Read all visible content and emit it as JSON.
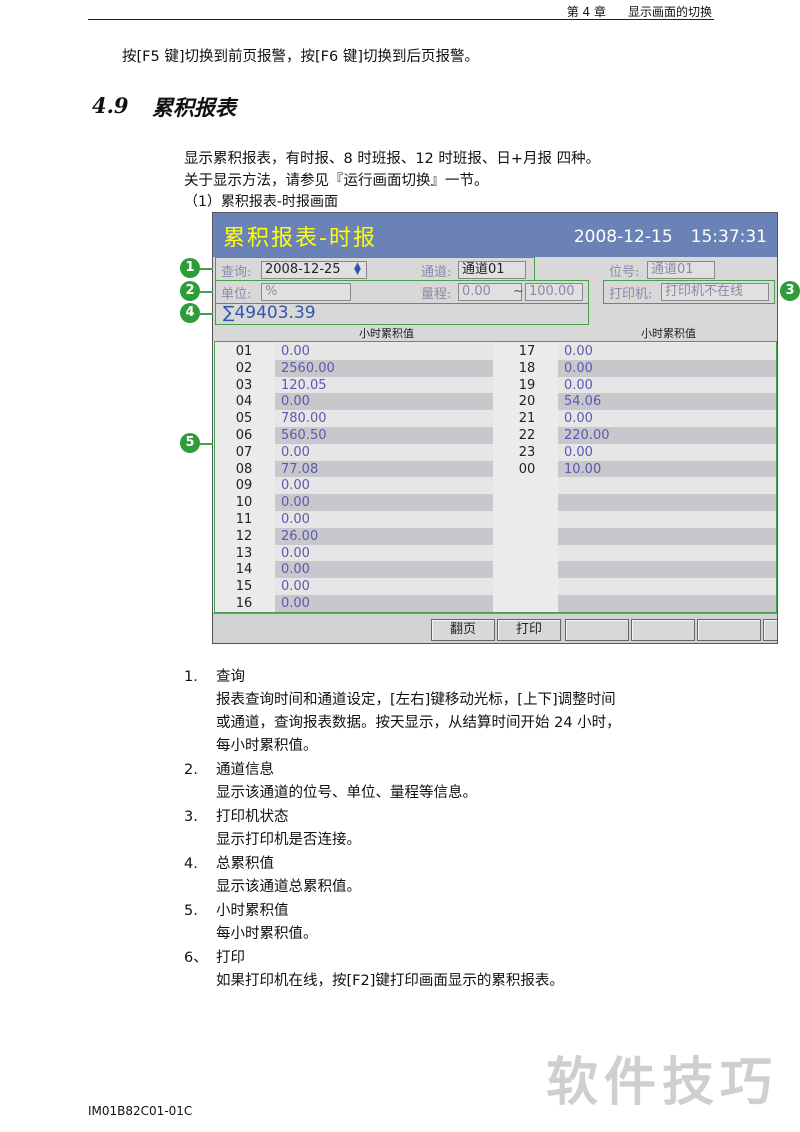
{
  "header": {
    "chapter": "第 4 章",
    "title": "显示画面的切换"
  },
  "intro_line": "按[F5 键]切换到前页报警，按[F6 键]切换到后页报警。",
  "section": {
    "number": "4.9",
    "title": "累积报表"
  },
  "body": {
    "line1": "显示累积报表，有时报、8 时班报、12 时班报、日+月报  四种。",
    "line2": "关于显示方法，请参见『运行画面切换』一节。",
    "fig_caption": "（1）累积报表-时报画面"
  },
  "screen": {
    "title": "累积报表-时报",
    "date": "2008-12-15",
    "time": "15:37:31",
    "query_label": "查询:",
    "query_value": "2008-12-25",
    "channel_label": "通道:",
    "channel_value": "通道01",
    "tag_label": "位号:",
    "tag_value": "通道01",
    "unit_label": "单位:",
    "unit_value": "%",
    "range_label": "量程:",
    "range_min": "0.00",
    "range_sep": "~",
    "range_max": "100.00",
    "printer_label": "打印机:",
    "printer_value": "打印机不在线",
    "total": "∑49403.39",
    "col_header_left": "小时累积值",
    "col_header_right": "小时累积值",
    "rows_left": [
      {
        "h": "01",
        "v": "0.00"
      },
      {
        "h": "02",
        "v": "2560.00"
      },
      {
        "h": "03",
        "v": "120.05"
      },
      {
        "h": "04",
        "v": "0.00"
      },
      {
        "h": "05",
        "v": "780.00"
      },
      {
        "h": "06",
        "v": "560.50"
      },
      {
        "h": "07",
        "v": "0.00"
      },
      {
        "h": "08",
        "v": "77.08"
      },
      {
        "h": "09",
        "v": "0.00"
      },
      {
        "h": "10",
        "v": "0.00"
      },
      {
        "h": "11",
        "v": "0.00"
      },
      {
        "h": "12",
        "v": "26.00"
      },
      {
        "h": "13",
        "v": "0.00"
      },
      {
        "h": "14",
        "v": "0.00"
      },
      {
        "h": "15",
        "v": "0.00"
      },
      {
        "h": "16",
        "v": "0.00"
      }
    ],
    "rows_right": [
      {
        "h": "17",
        "v": "0.00"
      },
      {
        "h": "18",
        "v": "0.00"
      },
      {
        "h": "19",
        "v": "0.00"
      },
      {
        "h": "20",
        "v": "54.06"
      },
      {
        "h": "21",
        "v": "0.00"
      },
      {
        "h": "22",
        "v": "220.00"
      },
      {
        "h": "23",
        "v": "0.00"
      },
      {
        "h": "00",
        "v": "10.00"
      },
      {
        "h": "",
        "v": ""
      },
      {
        "h": "",
        "v": ""
      },
      {
        "h": "",
        "v": ""
      },
      {
        "h": "",
        "v": ""
      },
      {
        "h": "",
        "v": ""
      },
      {
        "h": "",
        "v": ""
      },
      {
        "h": "",
        "v": ""
      },
      {
        "h": "",
        "v": ""
      }
    ],
    "fkeys": [
      "",
      "翻页",
      "打印",
      "",
      "",
      "",
      ""
    ]
  },
  "callouts": [
    "1",
    "2",
    "3",
    "4",
    "5"
  ],
  "list": [
    {
      "num": "1.",
      "title": "查询",
      "desc": [
        "报表查询时间和通道设定，[左右]键移动光标，[上下]调整时间",
        "或通道，查询报表数据。按天显示，从结算时间开始 24 小时，",
        "每小时累积值。"
      ]
    },
    {
      "num": "2.",
      "title": "通道信息",
      "desc": [
        "显示该通道的位号、单位、量程等信息。"
      ]
    },
    {
      "num": "3.",
      "title": "打印机状态",
      "desc": [
        "显示打印机是否连接。"
      ]
    },
    {
      "num": "4.",
      "title": "总累积值",
      "desc": [
        "显示该通道总累积值。"
      ]
    },
    {
      "num": "5.",
      "title": "小时累积值",
      "desc": [
        "每小时累积值。"
      ]
    },
    {
      "num": "6、",
      "title": "打印",
      "desc": [
        "如果打印机在线，按[F2]键打印画面显示的累积报表。"
      ]
    }
  ],
  "watermark": "软件技巧",
  "footer": "IM01B82C01-01C",
  "colors": {
    "title_bar": "#6a82b6",
    "title_text": "#ffff00",
    "callout": "#2f9c3a",
    "value_text": "#5a5ab0"
  }
}
